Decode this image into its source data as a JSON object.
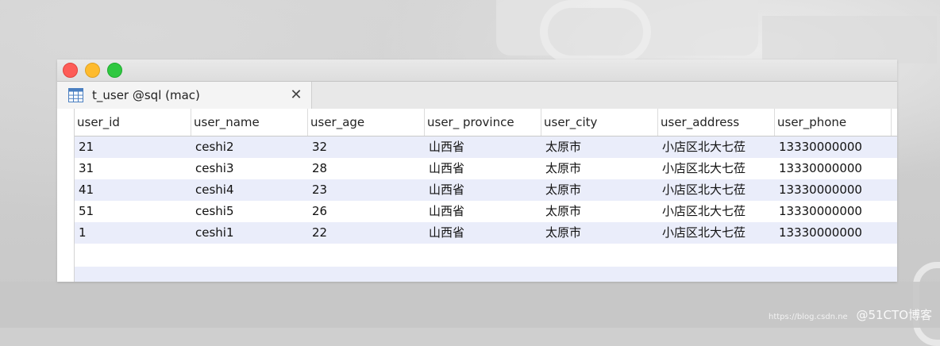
{
  "window": {
    "tab_title": "t_user @sql (mac)",
    "tab_close_glyph": "✕"
  },
  "table": {
    "columns": [
      "user_id",
      "user_name",
      "user_age",
      "user_ province",
      "user_city",
      "user_address",
      "user_phone"
    ],
    "rows": [
      [
        "21",
        "ceshi2",
        "32",
        "山西省",
        "太原市",
        "小店区北大七莅",
        "13330000000"
      ],
      [
        "31",
        "ceshi3",
        "28",
        "山西省",
        "太原市",
        "小店区北大七莅",
        "13330000000"
      ],
      [
        "41",
        "ceshi4",
        "23",
        "山西省",
        "太原市",
        "小店区北大七莅",
        "13330000000"
      ],
      [
        "51",
        "ceshi5",
        "26",
        "山西省",
        "太原市",
        "小店区北大七莅",
        "13330000000"
      ],
      [
        "1",
        "ceshi1",
        "22",
        "山西省",
        "太原市",
        "小店区北大七莅",
        "13330000000"
      ]
    ]
  },
  "watermark": {
    "url": "https://blog.csdn.ne",
    "text": "@51CTO博客"
  },
  "colors": {
    "row_alt": "#eaedfa",
    "close": "#fd5c57",
    "minimize": "#febb2e",
    "zoom": "#2fc840"
  }
}
